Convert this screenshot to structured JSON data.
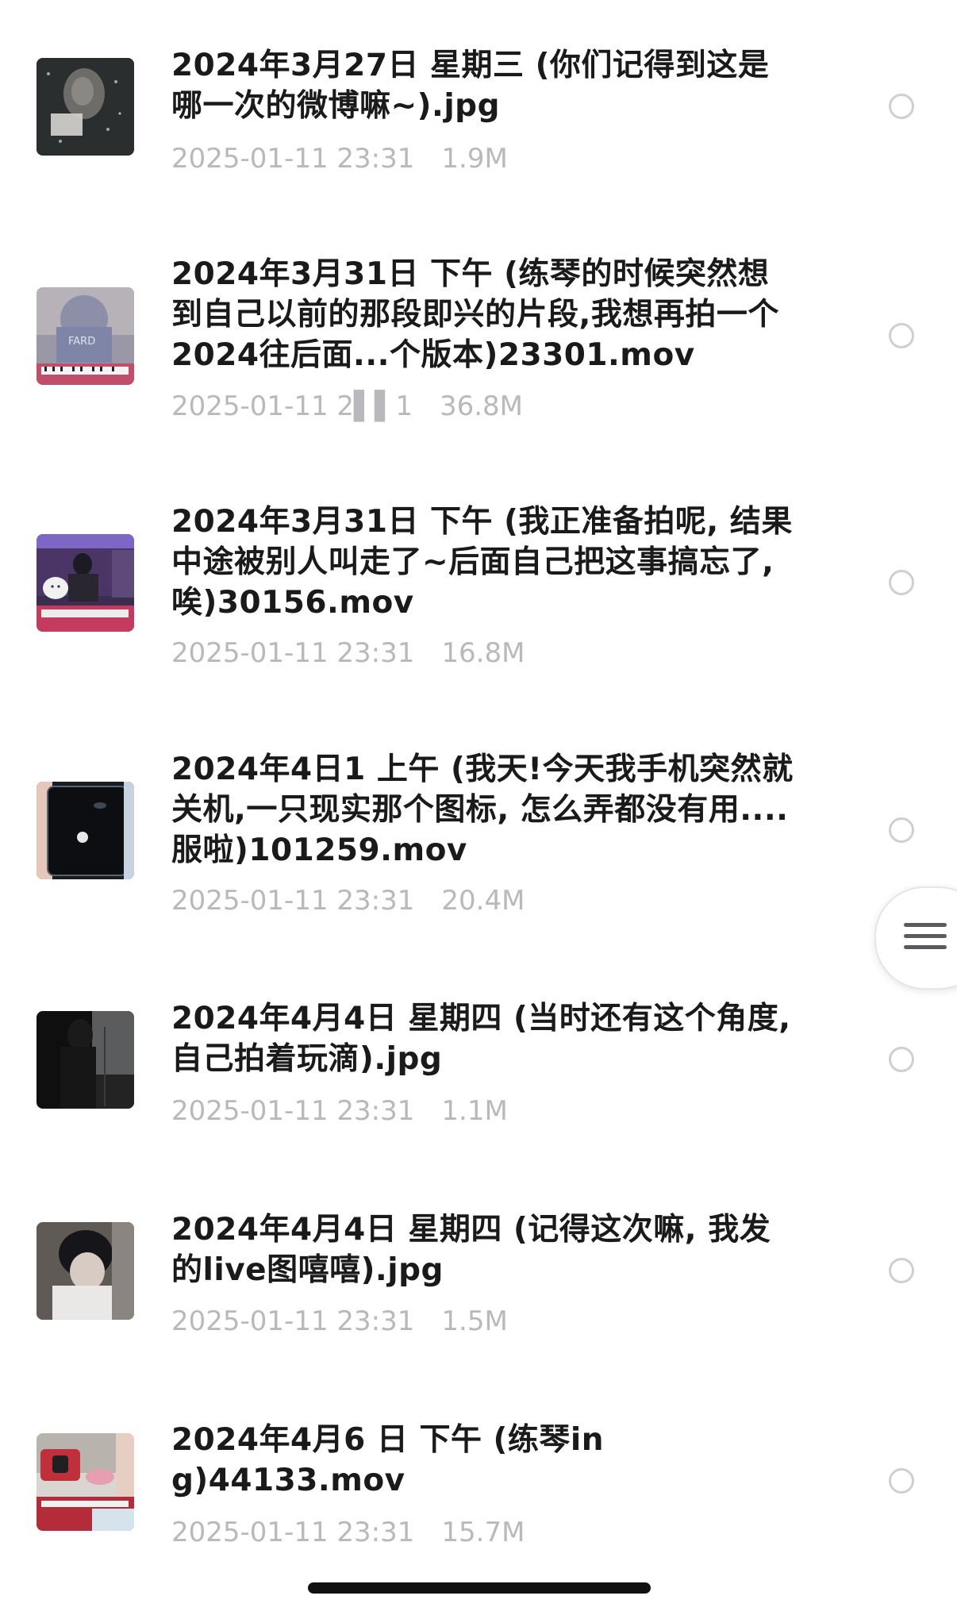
{
  "files": [
    {
      "name": "2024年3月27日 星期三 (你们记得到这是哪一次的微博嘛~).jpg",
      "date": "2025-01-11 23:31",
      "size": "1.9M",
      "thumb_icon": "photo-thumbnail-rainy-window"
    },
    {
      "name": "2024年3月31日 下午 (练琴的时候突然想到自己以前的那段即兴的片段,我想再拍一个2024往后面...个版本)23301.mov",
      "date": "2025-01-11 2▌▌1",
      "size": "36.8M",
      "thumb_icon": "video-thumbnail-piano"
    },
    {
      "name": "2024年3月31日 下午 (我正准备拍呢, 结果中途被别人叫走了~后面自己把这事搞忘了, 唉)30156.mov",
      "date": "2025-01-11 23:31",
      "size": "16.8M",
      "thumb_icon": "video-thumbnail-studio"
    },
    {
      "name": "2024年4日1 上午 (我天!今天我手机突然就关机,一只现实那个图标, 怎么弄都没有用.... 服啦)101259.mov",
      "date": "2025-01-11 23:31",
      "size": "20.4M",
      "thumb_icon": "video-thumbnail-phone-boot"
    },
    {
      "name": "2024年4月4日 星期四 (当时还有这个角度, 自己拍着玩滴).jpg",
      "date": "2025-01-11 23:31",
      "size": "1.1M",
      "thumb_icon": "photo-thumbnail-silhouette"
    },
    {
      "name": "2024年4月4日 星期四 (记得这次嘛, 我发的live图嘻嘻).jpg",
      "date": "2025-01-11 23:31",
      "size": "1.5M",
      "thumb_icon": "photo-thumbnail-portrait"
    },
    {
      "name": "2024年4月6 日 下午 (练琴ing)44133.mov",
      "date": "2025-01-11 23:31",
      "size": "15.7M",
      "thumb_icon": "video-thumbnail-keyboard"
    }
  ],
  "floating_menu": {
    "icon": "menu-icon"
  },
  "colors": {
    "title": "#1a1a1a",
    "meta": "#b8b8bd",
    "radio_border": "#cfcfd3",
    "home_indicator": "#111111"
  }
}
